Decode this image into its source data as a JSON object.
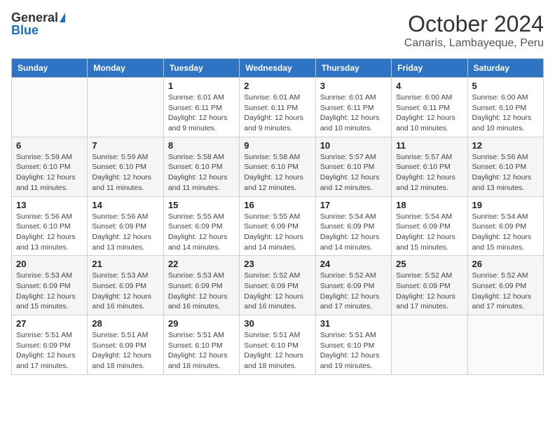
{
  "header": {
    "logo_general": "General",
    "logo_blue": "Blue",
    "month_year": "October 2024",
    "location": "Canaris, Lambayeque, Peru"
  },
  "weekdays": [
    "Sunday",
    "Monday",
    "Tuesday",
    "Wednesday",
    "Thursday",
    "Friday",
    "Saturday"
  ],
  "weeks": [
    [
      {
        "day": "",
        "info": ""
      },
      {
        "day": "",
        "info": ""
      },
      {
        "day": "1",
        "info": "Sunrise: 6:01 AM\nSunset: 6:11 PM\nDaylight: 12 hours\nand 9 minutes."
      },
      {
        "day": "2",
        "info": "Sunrise: 6:01 AM\nSunset: 6:11 PM\nDaylight: 12 hours\nand 9 minutes."
      },
      {
        "day": "3",
        "info": "Sunrise: 6:01 AM\nSunset: 6:11 PM\nDaylight: 12 hours\nand 10 minutes."
      },
      {
        "day": "4",
        "info": "Sunrise: 6:00 AM\nSunset: 6:11 PM\nDaylight: 12 hours\nand 10 minutes."
      },
      {
        "day": "5",
        "info": "Sunrise: 6:00 AM\nSunset: 6:10 PM\nDaylight: 12 hours\nand 10 minutes."
      }
    ],
    [
      {
        "day": "6",
        "info": "Sunrise: 5:59 AM\nSunset: 6:10 PM\nDaylight: 12 hours\nand 11 minutes."
      },
      {
        "day": "7",
        "info": "Sunrise: 5:59 AM\nSunset: 6:10 PM\nDaylight: 12 hours\nand 11 minutes."
      },
      {
        "day": "8",
        "info": "Sunrise: 5:58 AM\nSunset: 6:10 PM\nDaylight: 12 hours\nand 11 minutes."
      },
      {
        "day": "9",
        "info": "Sunrise: 5:58 AM\nSunset: 6:10 PM\nDaylight: 12 hours\nand 12 minutes."
      },
      {
        "day": "10",
        "info": "Sunrise: 5:57 AM\nSunset: 6:10 PM\nDaylight: 12 hours\nand 12 minutes."
      },
      {
        "day": "11",
        "info": "Sunrise: 5:57 AM\nSunset: 6:10 PM\nDaylight: 12 hours\nand 12 minutes."
      },
      {
        "day": "12",
        "info": "Sunrise: 5:56 AM\nSunset: 6:10 PM\nDaylight: 12 hours\nand 13 minutes."
      }
    ],
    [
      {
        "day": "13",
        "info": "Sunrise: 5:56 AM\nSunset: 6:10 PM\nDaylight: 12 hours\nand 13 minutes."
      },
      {
        "day": "14",
        "info": "Sunrise: 5:56 AM\nSunset: 6:09 PM\nDaylight: 12 hours\nand 13 minutes."
      },
      {
        "day": "15",
        "info": "Sunrise: 5:55 AM\nSunset: 6:09 PM\nDaylight: 12 hours\nand 14 minutes."
      },
      {
        "day": "16",
        "info": "Sunrise: 5:55 AM\nSunset: 6:09 PM\nDaylight: 12 hours\nand 14 minutes."
      },
      {
        "day": "17",
        "info": "Sunrise: 5:54 AM\nSunset: 6:09 PM\nDaylight: 12 hours\nand 14 minutes."
      },
      {
        "day": "18",
        "info": "Sunrise: 5:54 AM\nSunset: 6:09 PM\nDaylight: 12 hours\nand 15 minutes."
      },
      {
        "day": "19",
        "info": "Sunrise: 5:54 AM\nSunset: 6:09 PM\nDaylight: 12 hours\nand 15 minutes."
      }
    ],
    [
      {
        "day": "20",
        "info": "Sunrise: 5:53 AM\nSunset: 6:09 PM\nDaylight: 12 hours\nand 15 minutes."
      },
      {
        "day": "21",
        "info": "Sunrise: 5:53 AM\nSunset: 6:09 PM\nDaylight: 12 hours\nand 16 minutes."
      },
      {
        "day": "22",
        "info": "Sunrise: 5:53 AM\nSunset: 6:09 PM\nDaylight: 12 hours\nand 16 minutes."
      },
      {
        "day": "23",
        "info": "Sunrise: 5:52 AM\nSunset: 6:09 PM\nDaylight: 12 hours\nand 16 minutes."
      },
      {
        "day": "24",
        "info": "Sunrise: 5:52 AM\nSunset: 6:09 PM\nDaylight: 12 hours\nand 17 minutes."
      },
      {
        "day": "25",
        "info": "Sunrise: 5:52 AM\nSunset: 6:09 PM\nDaylight: 12 hours\nand 17 minutes."
      },
      {
        "day": "26",
        "info": "Sunrise: 5:52 AM\nSunset: 6:09 PM\nDaylight: 12 hours\nand 17 minutes."
      }
    ],
    [
      {
        "day": "27",
        "info": "Sunrise: 5:51 AM\nSunset: 6:09 PM\nDaylight: 12 hours\nand 17 minutes."
      },
      {
        "day": "28",
        "info": "Sunrise: 5:51 AM\nSunset: 6:09 PM\nDaylight: 12 hours\nand 18 minutes."
      },
      {
        "day": "29",
        "info": "Sunrise: 5:51 AM\nSunset: 6:10 PM\nDaylight: 12 hours\nand 18 minutes."
      },
      {
        "day": "30",
        "info": "Sunrise: 5:51 AM\nSunset: 6:10 PM\nDaylight: 12 hours\nand 18 minutes."
      },
      {
        "day": "31",
        "info": "Sunrise: 5:51 AM\nSunset: 6:10 PM\nDaylight: 12 hours\nand 19 minutes."
      },
      {
        "day": "",
        "info": ""
      },
      {
        "day": "",
        "info": ""
      }
    ]
  ]
}
